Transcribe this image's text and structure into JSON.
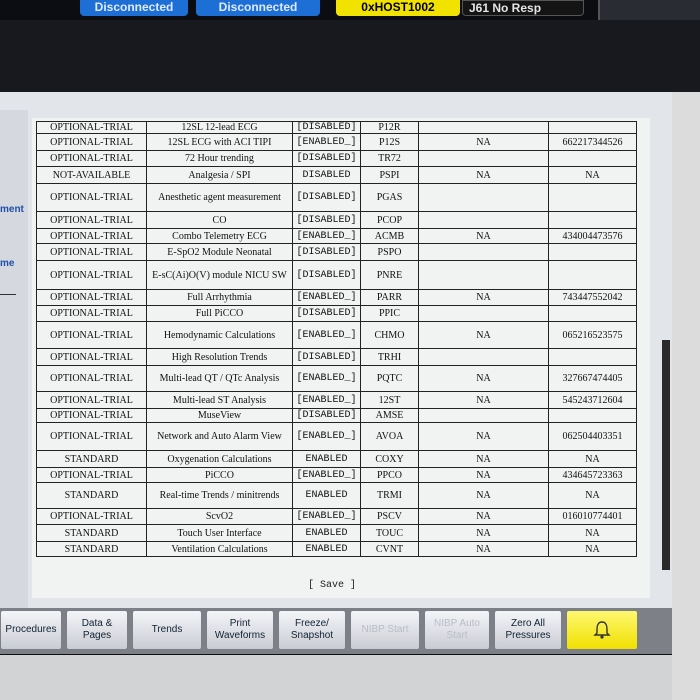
{
  "status_bar": {
    "items": [
      {
        "label": "Disconnected",
        "style": "blue"
      },
      {
        "label": "Disconnected",
        "style": "blue"
      },
      {
        "label": "0xHOST1002",
        "style": "yellow"
      },
      {
        "label": "J61 No Resp",
        "style": "black"
      }
    ]
  },
  "side_labels": [
    "ment",
    "me"
  ],
  "options_table": {
    "rows": [
      {
        "status": "OPTIONAL-TRIAL",
        "feature": "12SL 12-lead ECG",
        "mode": "[DISABLED]",
        "code": "P12R",
        "key": ""
      },
      {
        "status": "OPTIONAL-TRIAL",
        "feature": "12SL ECG with ACI TIPI",
        "mode": "[ENABLED_]",
        "code": "P12S",
        "key": "NA",
        "license": "662217344526"
      },
      {
        "status": "OPTIONAL-TRIAL",
        "feature": "72 Hour trending",
        "mode": "[DISABLED]",
        "code": "TR72",
        "key": "",
        "license": ""
      },
      {
        "status": "NOT-AVAILABLE",
        "feature": "Analgesia / SPI",
        "mode": "DISABLED",
        "code": "PSPI",
        "key": "NA",
        "license": "NA"
      },
      {
        "status": "OPTIONAL-TRIAL",
        "feature": "Anesthetic agent measurement",
        "mode": "[DISABLED]",
        "code": "PGAS",
        "key": "",
        "license": ""
      },
      {
        "status": "OPTIONAL-TRIAL",
        "feature": "CO",
        "mode": "[DISABLED]",
        "code": "PCOP",
        "key": "",
        "license": ""
      },
      {
        "status": "OPTIONAL-TRIAL",
        "feature": "Combo Telemetry ECG",
        "mode": "[ENABLED_]",
        "code": "ACMB",
        "key": "NA",
        "license": "434004473576"
      },
      {
        "status": "OPTIONAL-TRIAL",
        "feature": "E-SpO2 Module Neonatal",
        "mode": "[DISABLED]",
        "code": "PSPO",
        "key": "",
        "license": ""
      },
      {
        "status": "OPTIONAL-TRIAL",
        "feature": "E-sC(Ai)O(V) module NICU SW",
        "mode": "[DISABLED]",
        "code": "PNRE",
        "key": "",
        "license": ""
      },
      {
        "status": "OPTIONAL-TRIAL",
        "feature": "Full Arrhythmia",
        "mode": "[ENABLED_]",
        "code": "PARR",
        "key": "NA",
        "license": "743447552042"
      },
      {
        "status": "OPTIONAL-TRIAL",
        "feature": "Full PiCCO",
        "mode": "[DISABLED]",
        "code": "PPIC",
        "key": "",
        "license": ""
      },
      {
        "status": "OPTIONAL-TRIAL",
        "feature": "Hemodynamic Calculations",
        "mode": "[ENABLED_]",
        "code": "CHMO",
        "key": "NA",
        "license": "065216523575"
      },
      {
        "status": "OPTIONAL-TRIAL",
        "feature": "High Resolution Trends",
        "mode": "[DISABLED]",
        "code": "TRHI",
        "key": "",
        "license": ""
      },
      {
        "status": "OPTIONAL-TRIAL",
        "feature": "Multi-lead QT / QTc Analysis",
        "mode": "[ENABLED_]",
        "code": "PQTC",
        "key": "NA",
        "license": "327667474405"
      },
      {
        "status": "OPTIONAL-TRIAL",
        "feature": "Multi-lead ST Analysis",
        "mode": "[ENABLED_]",
        "code": "12ST",
        "key": "NA",
        "license": "545243712604"
      },
      {
        "status": "OPTIONAL-TRIAL",
        "feature": "MuseView",
        "mode": "[DISABLED]",
        "code": "AMSE",
        "key": "",
        "license": ""
      },
      {
        "status": "OPTIONAL-TRIAL",
        "feature": "Network and Auto Alarm View",
        "mode": "[ENABLED_]",
        "code": "AVOA",
        "key": "NA",
        "license": "062504403351"
      },
      {
        "status": "STANDARD",
        "feature": "Oxygenation Calculations",
        "mode": "ENABLED",
        "code": "COXY",
        "key": "NA",
        "license": "NA"
      },
      {
        "status": "OPTIONAL-TRIAL",
        "feature": "PiCCO",
        "mode": "[ENABLED_]",
        "code": "PPCO",
        "key": "NA",
        "license": "434645723363"
      },
      {
        "status": "STANDARD",
        "feature": "Real-time Trends / minitrends",
        "mode": "ENABLED",
        "code": "TRMI",
        "key": "NA",
        "license": "NA"
      },
      {
        "status": "OPTIONAL-TRIAL",
        "feature": "ScvO2",
        "mode": "[ENABLED_]",
        "code": "PSCV",
        "key": "NA",
        "license": "016010774401"
      },
      {
        "status": "STANDARD",
        "feature": "Touch User Interface",
        "mode": "ENABLED",
        "code": "TOUC",
        "key": "NA",
        "license": "NA"
      },
      {
        "status": "STANDARD",
        "feature": "Ventilation Calculations",
        "mode": "ENABLED",
        "code": "CVNT",
        "key": "NA",
        "license": "NA"
      }
    ]
  },
  "save_label": "[ Save ]",
  "buttons": [
    {
      "label": "Procedures",
      "enabled": true
    },
    {
      "label": "Data & Pages",
      "enabled": true
    },
    {
      "label": "Trends",
      "enabled": true
    },
    {
      "label": "Print Waveforms",
      "enabled": true
    },
    {
      "label": "Freeze/ Snapshot",
      "enabled": true
    },
    {
      "label": "NIBP Start",
      "enabled": false
    },
    {
      "label": "NIBP Auto Start",
      "enabled": false
    },
    {
      "label": "Zero All Pressures",
      "enabled": true
    }
  ],
  "alarm_icon": "alarm-bell-icon",
  "colors": {
    "status_blue": "#1d6fd6",
    "status_yellow": "#f2e200",
    "screen_bg": "#e2e5ea"
  }
}
